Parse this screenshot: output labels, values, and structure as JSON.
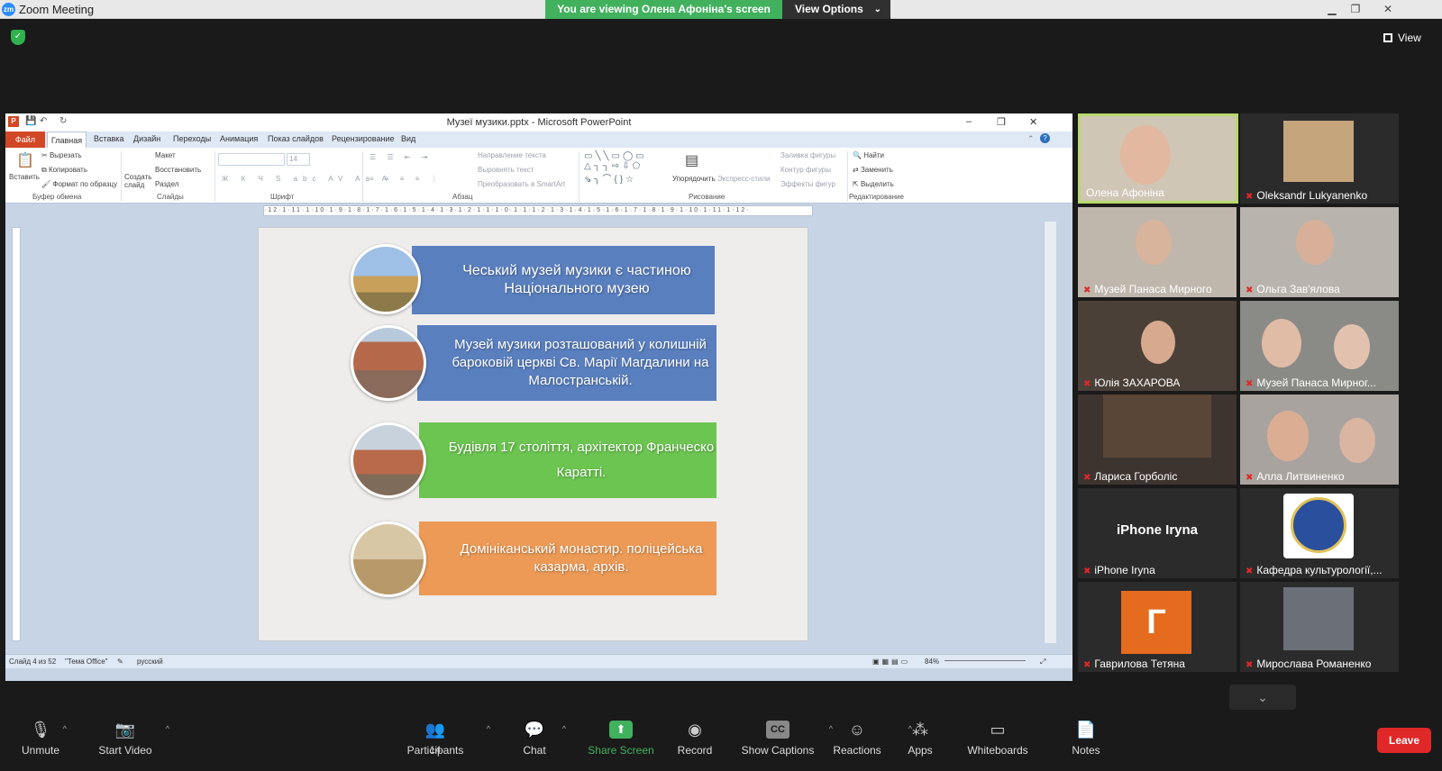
{
  "window": {
    "app_title": "Zoom Meeting",
    "viewing_banner": "You are viewing Олена Афоніна's screen",
    "view_options": "View Options",
    "view_label": "View"
  },
  "ppt": {
    "title": "Музеї музики.pptx - Microsoft PowerPoint",
    "tabs": [
      "Файл",
      "Главная",
      "Вставка",
      "Дизайн",
      "Переходы",
      "Анимация",
      "Показ слайдов",
      "Рецензирование",
      "Вид"
    ],
    "ribbon": {
      "paste": "Вставить",
      "cut": "Вырезать",
      "copy": "Копировать",
      "format_painter": "Формат по образцу",
      "new_slide": "Создать слайд",
      "layout": "Макет",
      "reset": "Восстановить",
      "section": "Раздел",
      "font_size": "14",
      "text_direction": "Направление текста",
      "align_text": "Выровнять текст",
      "smartart": "Преобразовать в SmartArt",
      "arrange": "Упорядочить",
      "quick_styles": "Экспресс-стили",
      "shape_fill": "Заливка фигуры",
      "shape_outline": "Контур фигуры",
      "shape_effects": "Эффекты фигур",
      "find": "Найти",
      "replace": "Заменить",
      "select": "Выделить",
      "groups": [
        "Буфер обмена",
        "Слайды",
        "Шрифт",
        "Абзац",
        "Рисование",
        "Редактирование"
      ]
    },
    "ruler_text": "·12·1·11·1·10·1·9·1·8·1·7·1·6·1·5·1·4·1·3·1·2·1·1·1·0·1·1·1·2·1·3·1·4·1·5·1·6·1·7·1·8·1·9·1·10·1·11·1·12·",
    "slide": {
      "box1": "Чеський музей музики є частиною Національного музею",
      "box2": "Музей музики розташований у колишній бароковій церкві Св. Марії Магдалини на Малостранській.",
      "box3": "Будівля 17 століття, архітектор Франческо Каратті.",
      "box4": "Домініканський монастир. поліцейська казарма, архів."
    },
    "status": {
      "slide_info": "Слайд 4 из 52",
      "theme": "\"Тема Office\"",
      "language": "русский",
      "zoom": "84%"
    }
  },
  "participants": [
    {
      "name": "Олена Афоніна",
      "muted": false
    },
    {
      "name": "Oleksandr Lukyanenko",
      "muted": true
    },
    {
      "name": "Музей Панаса Мирного",
      "muted": true
    },
    {
      "name": "Ольга Зав'ялова",
      "muted": true
    },
    {
      "name": "Юлія ЗАХАРОВА",
      "muted": true
    },
    {
      "name": "Музей Панаса Мирног...",
      "muted": true
    },
    {
      "name": "Лариса Горболіс",
      "muted": true
    },
    {
      "name": "Алла Литвиненко",
      "muted": true
    },
    {
      "name": "iPhone Iryna",
      "muted": true
    },
    {
      "name": "Кафедра культурології,...",
      "muted": true
    },
    {
      "name": "Гаврилова Тетяна",
      "muted": true
    },
    {
      "name": "Мирослава Романенко",
      "muted": true
    }
  ],
  "tile_extras": {
    "iphone_center": "iPhone Iryna",
    "avatar_letter": "Г"
  },
  "toolbar": {
    "unmute": "Unmute",
    "start_video": "Start Video",
    "participants": "Participants",
    "participants_count": "14",
    "chat": "Chat",
    "share_screen": "Share Screen",
    "record": "Record",
    "captions": "Show Captions",
    "reactions": "Reactions",
    "apps": "Apps",
    "whiteboards": "Whiteboards",
    "notes": "Notes",
    "leave": "Leave"
  },
  "colors": {
    "share_green": "#41b15e",
    "leave_red": "#e02828",
    "box_blue": "#5a7fbf",
    "box_green": "#6cc551",
    "box_orange": "#ec9a55",
    "active_border": "#b8d96b"
  }
}
